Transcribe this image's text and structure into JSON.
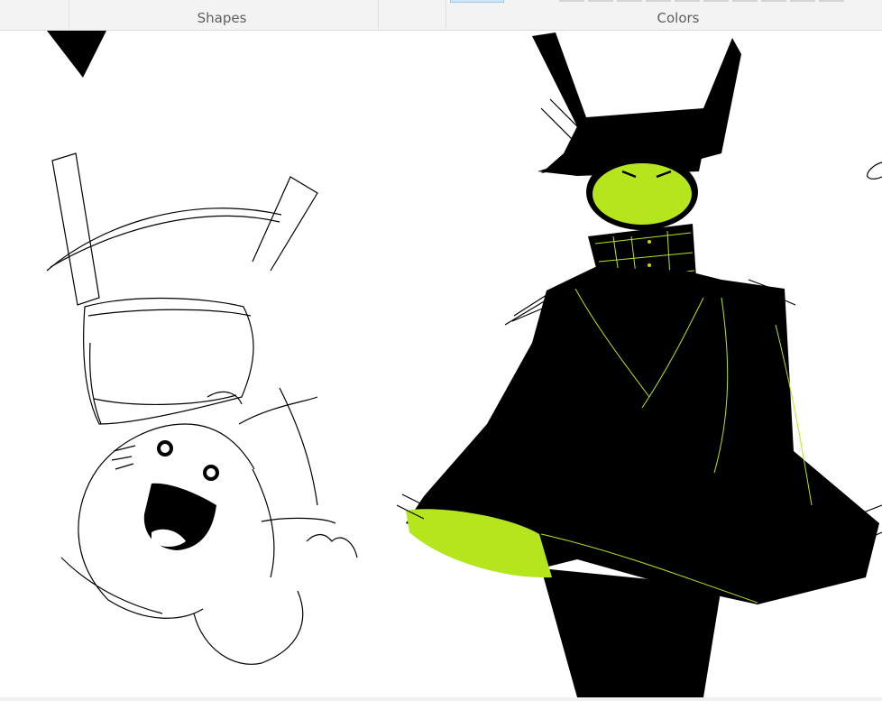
{
  "ribbon": {
    "groups": [
      {
        "label": "Shapes"
      },
      {
        "label": "Colors"
      }
    ]
  },
  "colors": {
    "ribbon_bg": "#f3f3f3",
    "accent_selected": "#99c9ef",
    "cloak_black": "#000000",
    "lime": "#b5e61d",
    "canvas_bg": "#ffffff"
  },
  "canvas": {
    "content": "drawing"
  }
}
